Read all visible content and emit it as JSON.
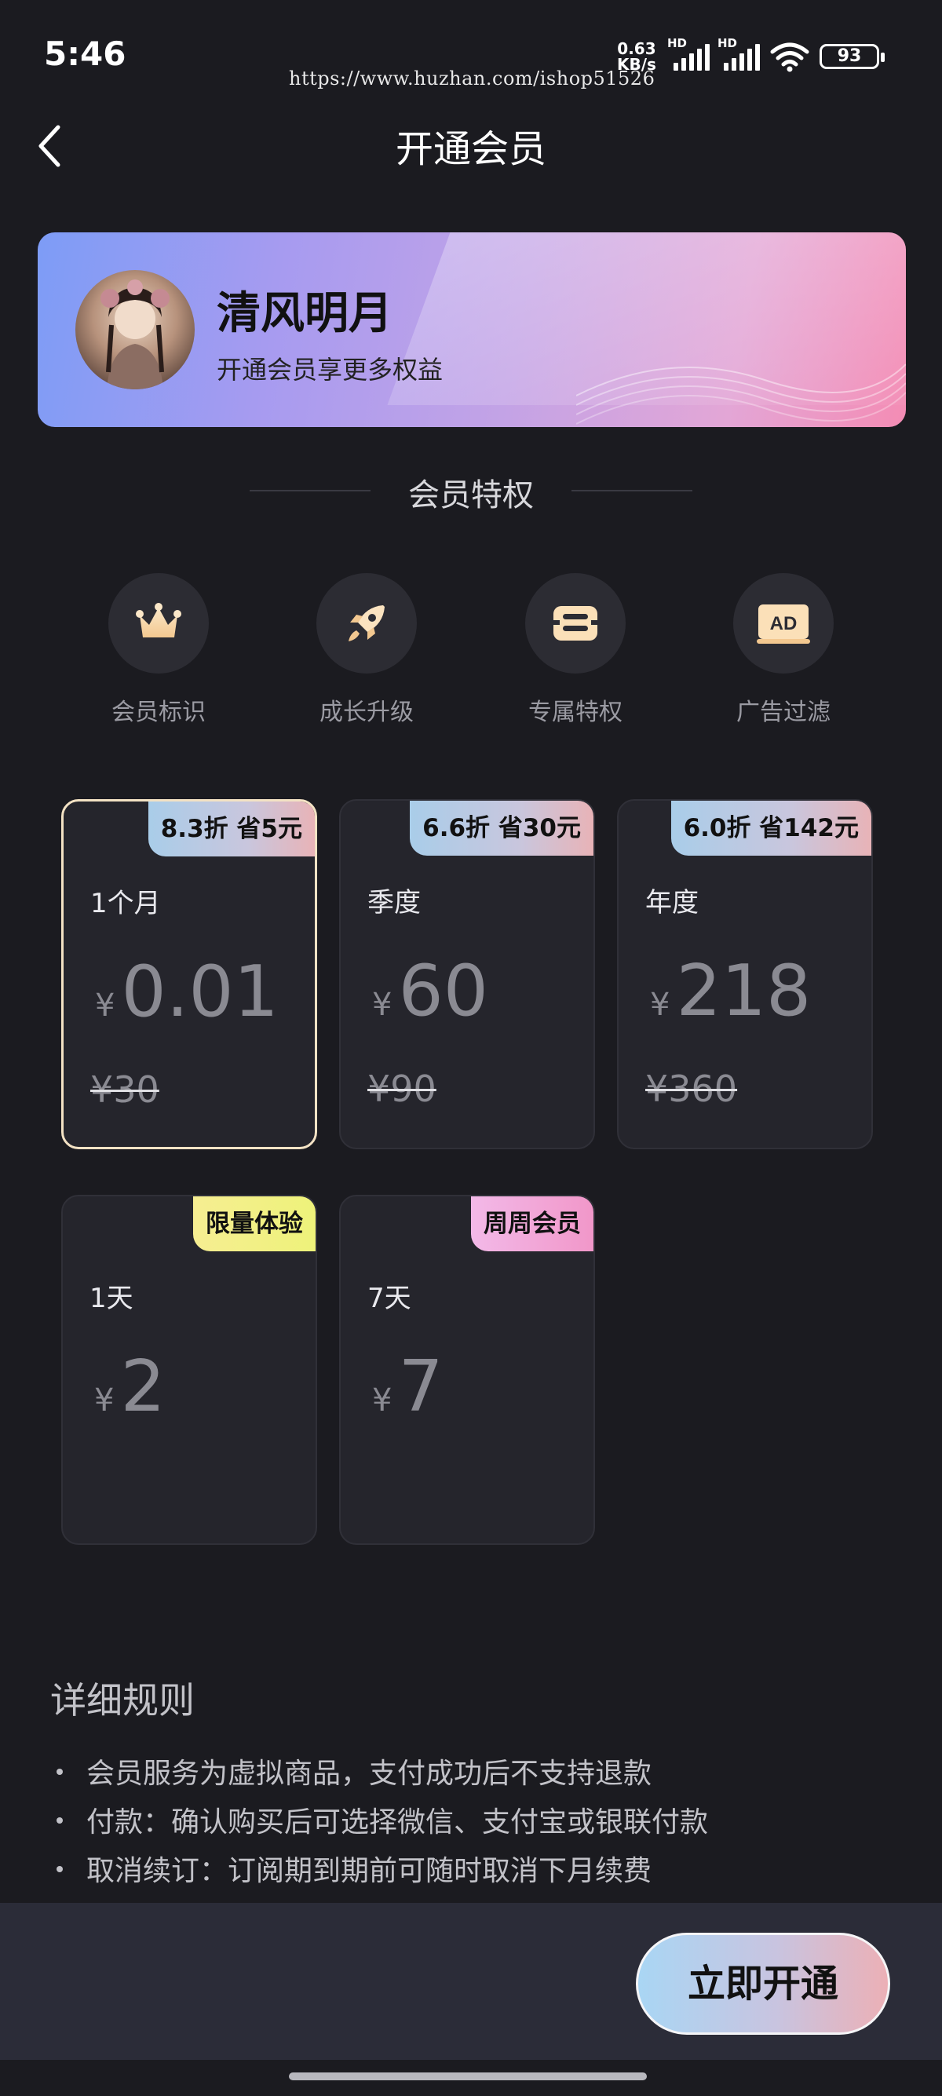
{
  "status_bar": {
    "time": "5:46",
    "watermark": "https://www.huzhan.com/ishop51526",
    "net_speed_value": "0.63",
    "net_speed_unit": "KB/s",
    "sim1_label": "HD",
    "sim2_label": "HD",
    "battery": "93"
  },
  "header": {
    "title": "开通会员"
  },
  "user_card": {
    "name": "清风明月",
    "subtitle": "开通会员享更多权益"
  },
  "privileges": {
    "title": "会员特权",
    "items": [
      {
        "label": "会员标识",
        "icon": "crown-icon"
      },
      {
        "label": "成长升级",
        "icon": "rocket-icon"
      },
      {
        "label": "专属特权",
        "icon": "exclusive-icon"
      },
      {
        "label": "广告过滤",
        "icon": "ad-filter-icon",
        "icon_text": "AD"
      }
    ]
  },
  "plans": [
    {
      "name": "1个月",
      "badge": "8.3折 省5元",
      "currency": "¥",
      "price": "0.01",
      "original": "¥30",
      "selected": true
    },
    {
      "name": "季度",
      "badge": "6.6折 省30元",
      "currency": "¥",
      "price": "60",
      "original": "¥90",
      "selected": false
    },
    {
      "name": "年度",
      "badge": "6.0折 省142元",
      "currency": "¥",
      "price": "218",
      "original": "¥360",
      "selected": false
    },
    {
      "name": "1天",
      "badge": "限量体验",
      "currency": "¥",
      "price": "2",
      "selected": false
    },
    {
      "name": "7天",
      "badge": "周周会员",
      "currency": "¥",
      "price": "7",
      "selected": false
    }
  ],
  "rules": {
    "title": "详细规则",
    "items": [
      "会员服务为虚拟商品，支付成功后不支持退款",
      "付款：确认购买后可选择微信、支付宝或银联付款",
      "取消续订：订阅期到期前可随时取消下月续费"
    ]
  },
  "action": {
    "buy_label": "立即开通"
  },
  "colors": {
    "background": "#1b1b20",
    "card": "#25252c",
    "selected_border": "#f3e2c4",
    "bottom_bar": "#2b2c38"
  }
}
